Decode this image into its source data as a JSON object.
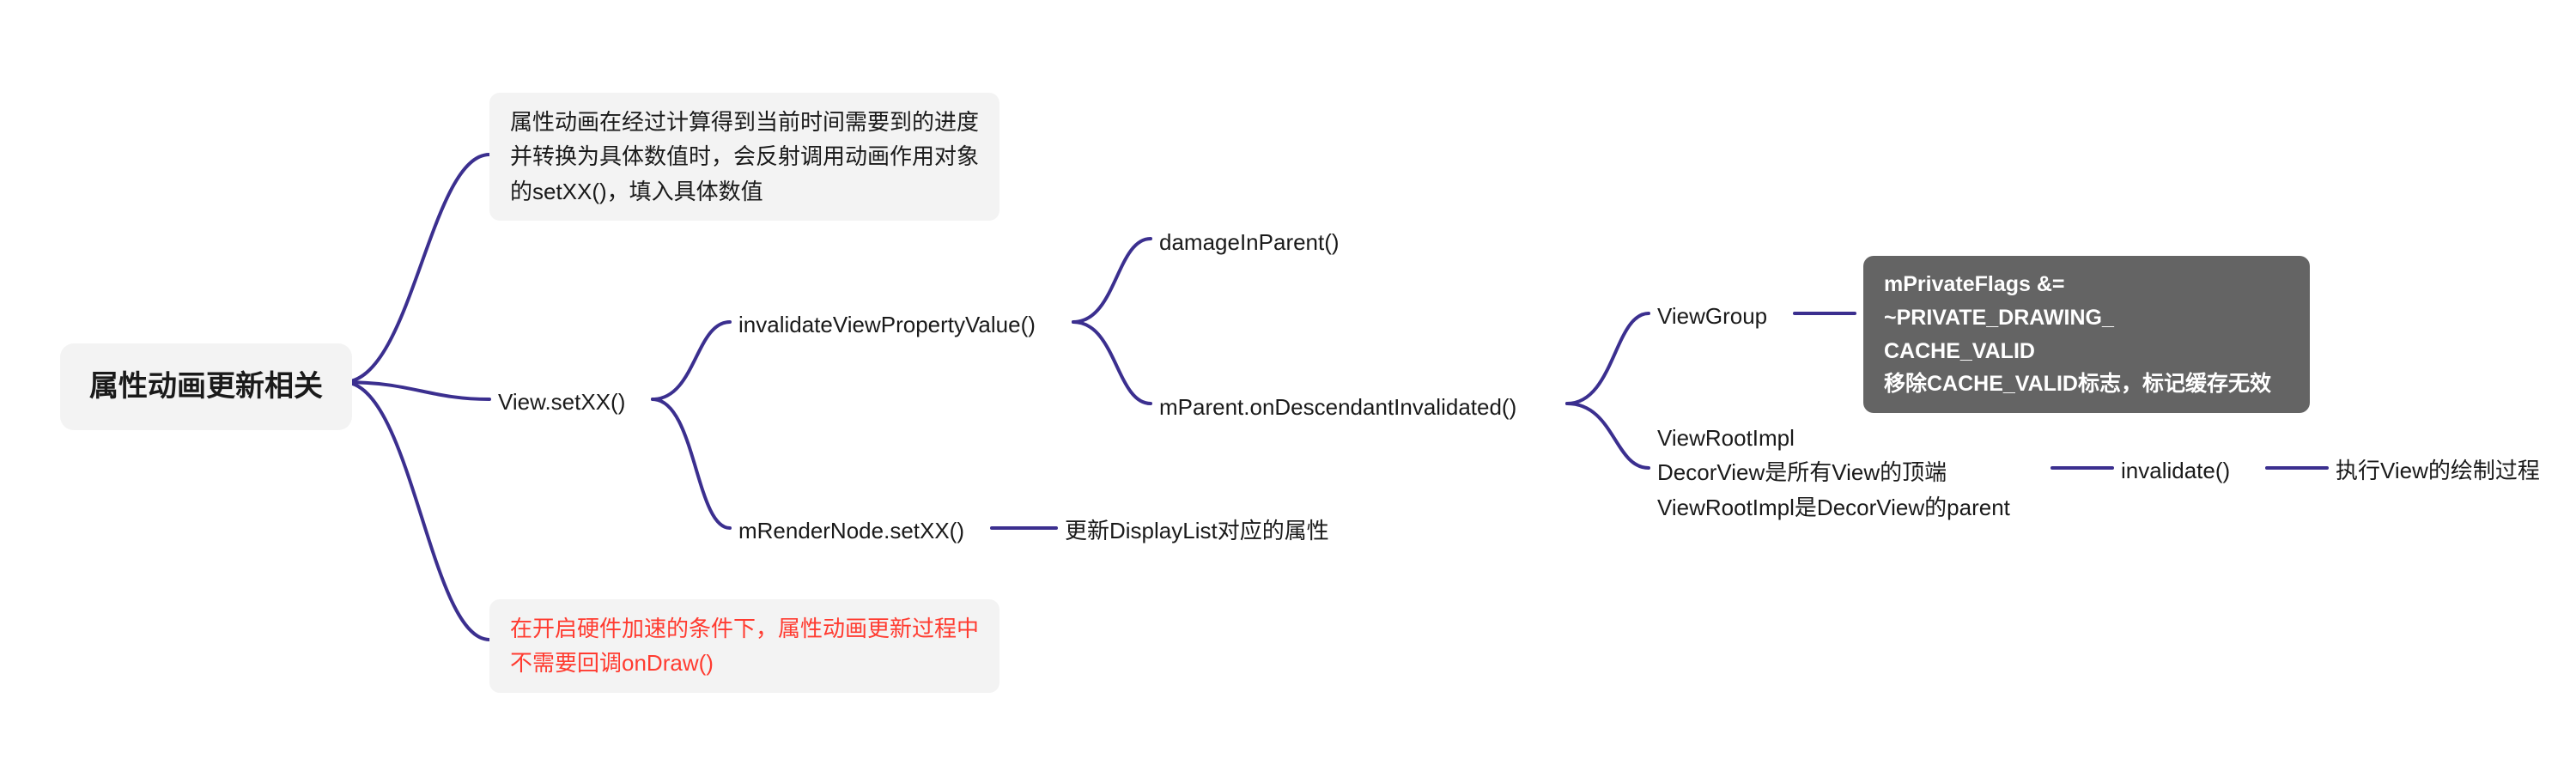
{
  "chart_data": {
    "type": "mindmap",
    "root": "属性动画更新相关",
    "children": [
      {
        "text": "属性动画在经过计算得到当前时间需要到的进度并转换为具体数值时，会反射调用动画作用对象的setXX()，填入具体数值"
      },
      {
        "text": "View.setXX()",
        "children": [
          {
            "text": "invalidateViewPropertyValue()",
            "children": [
              {
                "text": "damageInParent()"
              },
              {
                "text": "mParent.onDescendantInvalidated()",
                "children": [
                  {
                    "text": "ViewGroup",
                    "children": [
                      {
                        "text": "mPrivateFlags &= ~PRIVATE_DRAWING_CACHE_VALID\n移除CACHE_VALID标志，标记缓存无效",
                        "highlight": true
                      }
                    ]
                  },
                  {
                    "text": "ViewRootImpl\nDecorView是所有View的顶端\nViewRootImpl是DecorView的parent",
                    "children": [
                      {
                        "text": "invalidate()",
                        "children": [
                          {
                            "text": "执行View的绘制过程"
                          }
                        ]
                      }
                    ]
                  }
                ]
              }
            ]
          },
          {
            "text": "mRenderNode.setXX()",
            "children": [
              {
                "text": "更新DisplayList对应的属性"
              }
            ]
          }
        ]
      },
      {
        "text": "在开启硬件加速的条件下，属性动画更新过程中不需要回调onDraw()",
        "color": "red"
      }
    ]
  },
  "root": {
    "label": "属性动画更新相关"
  },
  "n_desc": {
    "line1": "属性动画在经过计算得到当前时间需要到的进度",
    "line2": "并转换为具体数值时，会反射调用动画作用对象",
    "line3": "的setXX()，填入具体数值"
  },
  "n_setxx": {
    "label": "View.setXX()"
  },
  "n_hw": {
    "line1": "在开启硬件加速的条件下，属性动画更新过程中",
    "line2": "不需要回调onDraw()"
  },
  "n_invalidate": {
    "label": "invalidateViewPropertyValue()"
  },
  "n_render": {
    "label": "mRenderNode.setXX()"
  },
  "n_displaylist": {
    "label": "更新DisplayList对应的属性"
  },
  "n_damage": {
    "label": "damageInParent()"
  },
  "n_descendant": {
    "label": "mParent.onDescendantInvalidated()"
  },
  "n_viewgroup": {
    "label": "ViewGroup"
  },
  "n_flags": {
    "line1": "mPrivateFlags &= ~PRIVATE_DRAWING_",
    "line2": "CACHE_VALID",
    "line3": "移除CACHE_VALID标志，标记缓存无效"
  },
  "n_viewroot": {
    "line1": "ViewRootImpl",
    "line2": "DecorView是所有View的顶端",
    "line3": "ViewRootImpl是DecorView的parent"
  },
  "n_invalidate2": {
    "label": "invalidate()"
  },
  "n_viewdraw": {
    "label": "执行View的绘制过程"
  }
}
